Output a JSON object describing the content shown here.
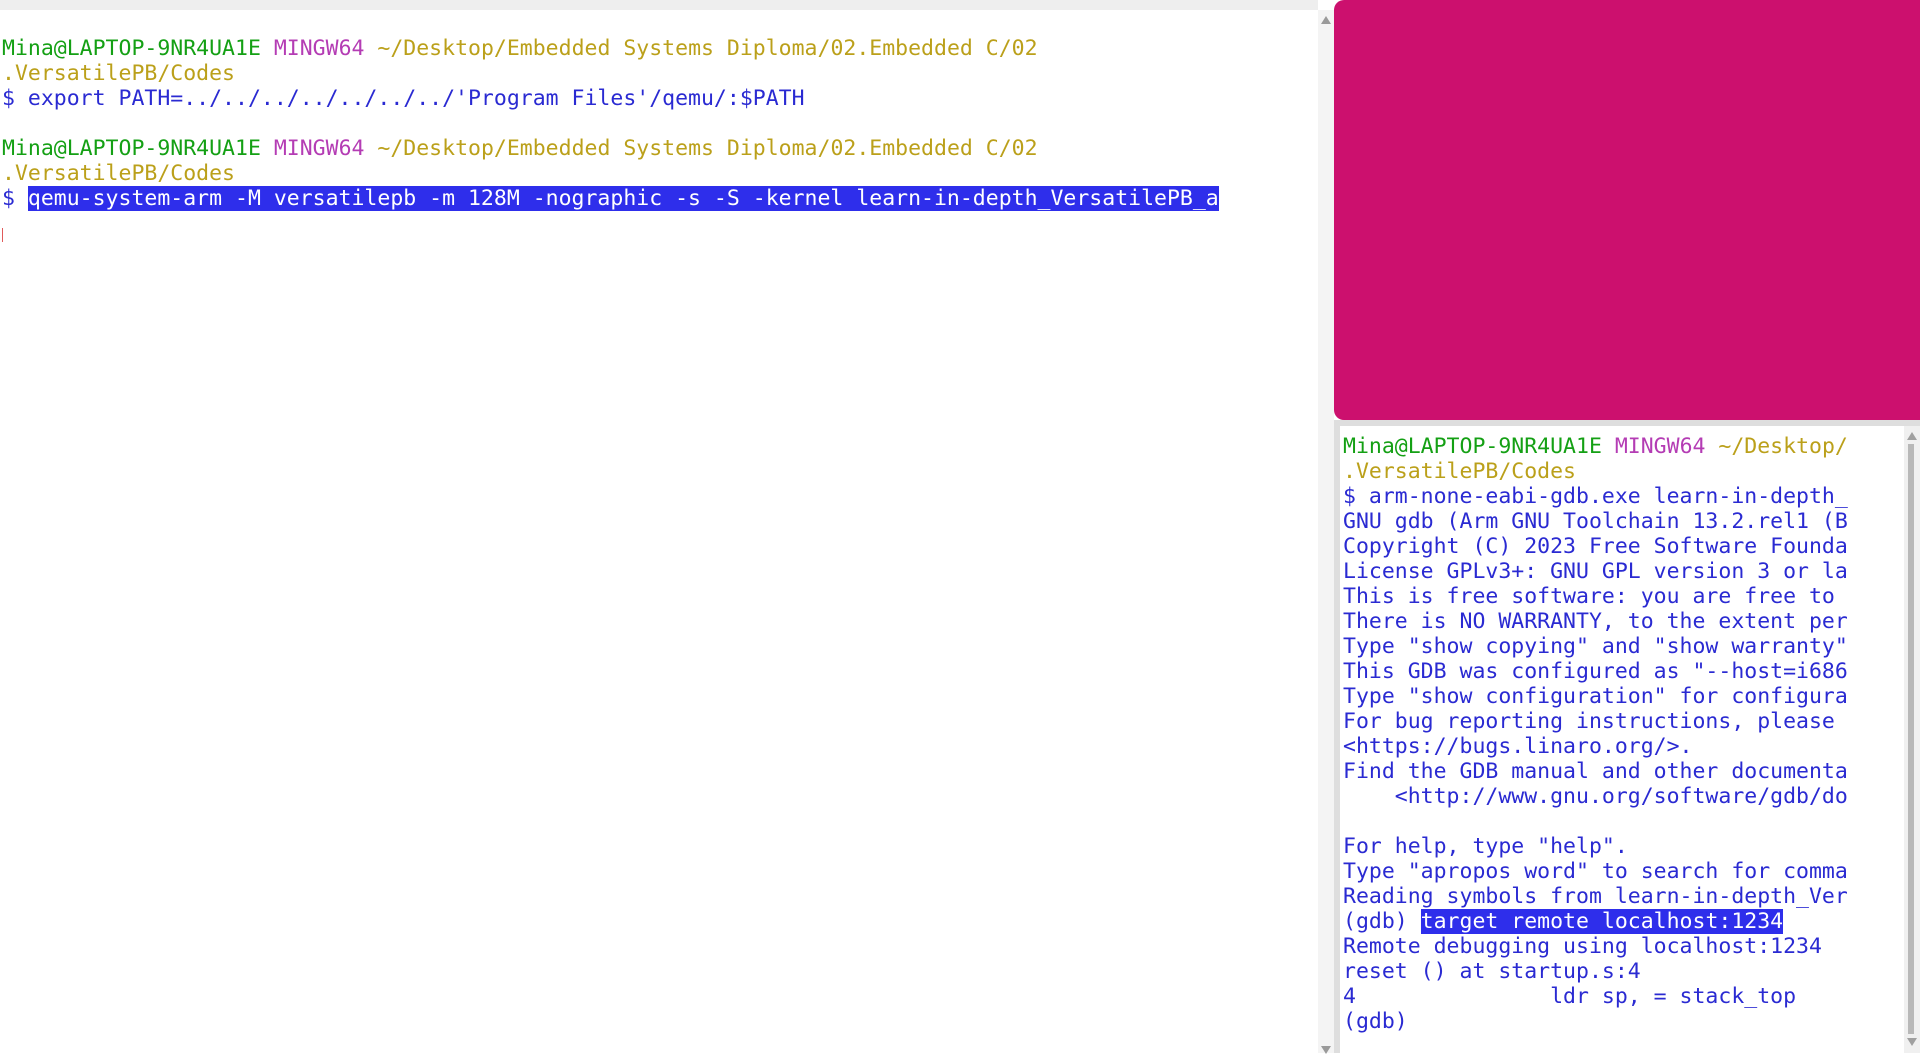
{
  "left_terminal": {
    "prompt1": {
      "user": "Mina@LAPTOP-9NR4UA1E",
      "system": "MINGW64",
      "path": "~/Desktop/Embedded Systems Diploma/02.Embedded C/02",
      "path_cont": ".VersatilePB/Codes"
    },
    "command1": "$ export PATH=../../../../../../../'Program Files'/qemu/:$PATH",
    "prompt2": {
      "user": "Mina@LAPTOP-9NR4UA1E",
      "system": "MINGW64",
      "path": "~/Desktop/Embedded Systems Diploma/02.Embedded C/02",
      "path_cont": ".VersatilePB/Codes"
    },
    "command2_symbol": "$ ",
    "command2": "qemu-system-arm -M versatilepb -m 128M -nographic -s -S -kernel learn-in-depth_VersatilePB_a"
  },
  "right_terminal": {
    "prompt": {
      "user": "Mina@LAPTOP-9NR4UA1E",
      "system": "MINGW64",
      "path": "~/Desktop/",
      "path_cont": ".VersatilePB/Codes"
    },
    "output": [
      "$ arm-none-eabi-gdb.exe learn-in-depth_",
      "GNU gdb (Arm GNU Toolchain 13.2.rel1 (B",
      "Copyright (C) 2023 Free Software Founda",
      "License GPLv3+: GNU GPL version 3 or la",
      "This is free software: you are free to",
      "There is NO WARRANTY, to the extent per",
      "Type \"show copying\" and \"show warranty\"",
      "This GDB was configured as \"--host=i686",
      "Type \"show configuration\" for configura",
      "For bug reporting instructions, please",
      "<https://bugs.linaro.org/>.",
      "Find the GDB manual and other documenta",
      "    <http://www.gnu.org/software/gdb/do",
      "",
      "For help, type \"help\".",
      "Type \"apropos word\" to search for comma",
      "Reading symbols from learn-in-depth_Ver"
    ],
    "gdb_prompt": "(gdb) ",
    "gdb_command": "target remote localhost:1234",
    "output_after": [
      "Remote debugging using localhost:1234",
      "reset () at startup.s:4",
      "4               ldr sp, = stack_top",
      "(gdb)"
    ]
  },
  "colors": {
    "prompt_user": "#14a014",
    "prompt_system": "#b43cb4",
    "prompt_path": "#bba01a",
    "text": "#2a2ad2",
    "selection": "#2e2eeb",
    "panel": "#cc106e"
  }
}
